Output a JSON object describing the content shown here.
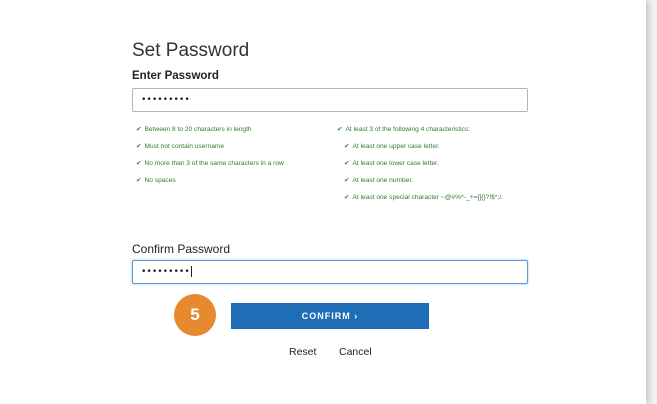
{
  "title": "Set Password",
  "enter_password": {
    "label": "Enter Password",
    "value": "•••••••••"
  },
  "rules_left": [
    {
      "icon": "check-icon",
      "text": "Between 8 to 20 characters in length"
    },
    {
      "icon": "check-icon",
      "text": "Must not contain username"
    },
    {
      "icon": "check-icon",
      "text": "No more than 3 of the same characters in a row"
    },
    {
      "icon": "check-icon",
      "text": "No spaces"
    }
  ],
  "rules_right_header": {
    "icon": "check-icon",
    "text": "At least 3 of the following 4 characteristics:"
  },
  "rules_right": [
    {
      "icon": "check-icon",
      "text": "At least one upper case letter."
    },
    {
      "icon": "check-icon",
      "text": "At least one lower case letter."
    },
    {
      "icon": "check-icon",
      "text": "At least one number."
    },
    {
      "icon": "check-icon",
      "text": "At least one special character ~@#%^-_+=[]{}?!$*;/."
    }
  ],
  "confirm_password": {
    "label": "Confirm Password",
    "value": "•••••••••"
  },
  "step_badge": "5",
  "confirm_button": "CONFIRM ›",
  "reset_label": "Reset",
  "cancel_label": "Cancel",
  "colors": {
    "accent": "#1f6eb5",
    "badge": "#e58a2f",
    "rule_ok": "#2e7d32"
  }
}
